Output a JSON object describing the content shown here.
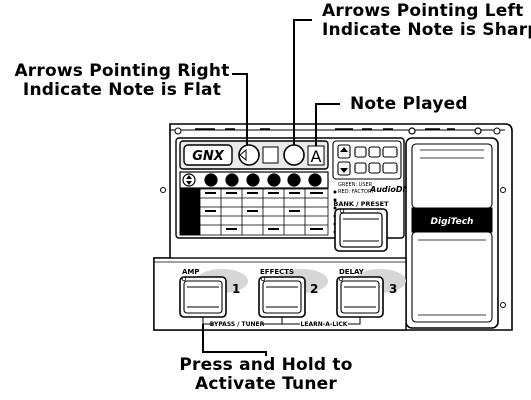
{
  "callouts": {
    "sharp": {
      "line1": "Arrows Pointing Left",
      "line2": "Indicate Note is Sharp"
    },
    "flat": {
      "line1": "Arrows Pointing Right",
      "line2": "Indicate Note is Flat"
    },
    "note": {
      "line1": "Note Played"
    },
    "tuner": {
      "line1": "Press and Hold to",
      "line2": "Activate Tuner"
    }
  },
  "device": {
    "logo": "GNX",
    "display_note": "A",
    "status_text_1": "GREEN: USER",
    "status_text_2": "RED: FACTORY",
    "audiodna": "AudioDNA",
    "brand": "DigiTech",
    "bank_preset_label": "BANK / PRESET",
    "footswitches": [
      {
        "label": "AMP",
        "number": "1"
      },
      {
        "label": "EFFECTS",
        "number": "2"
      },
      {
        "label": "DELAY",
        "number": "3"
      }
    ],
    "bypass_tuner_label": "BYPASS / TUNER",
    "learn_label": "LEARN-A-LICK"
  }
}
